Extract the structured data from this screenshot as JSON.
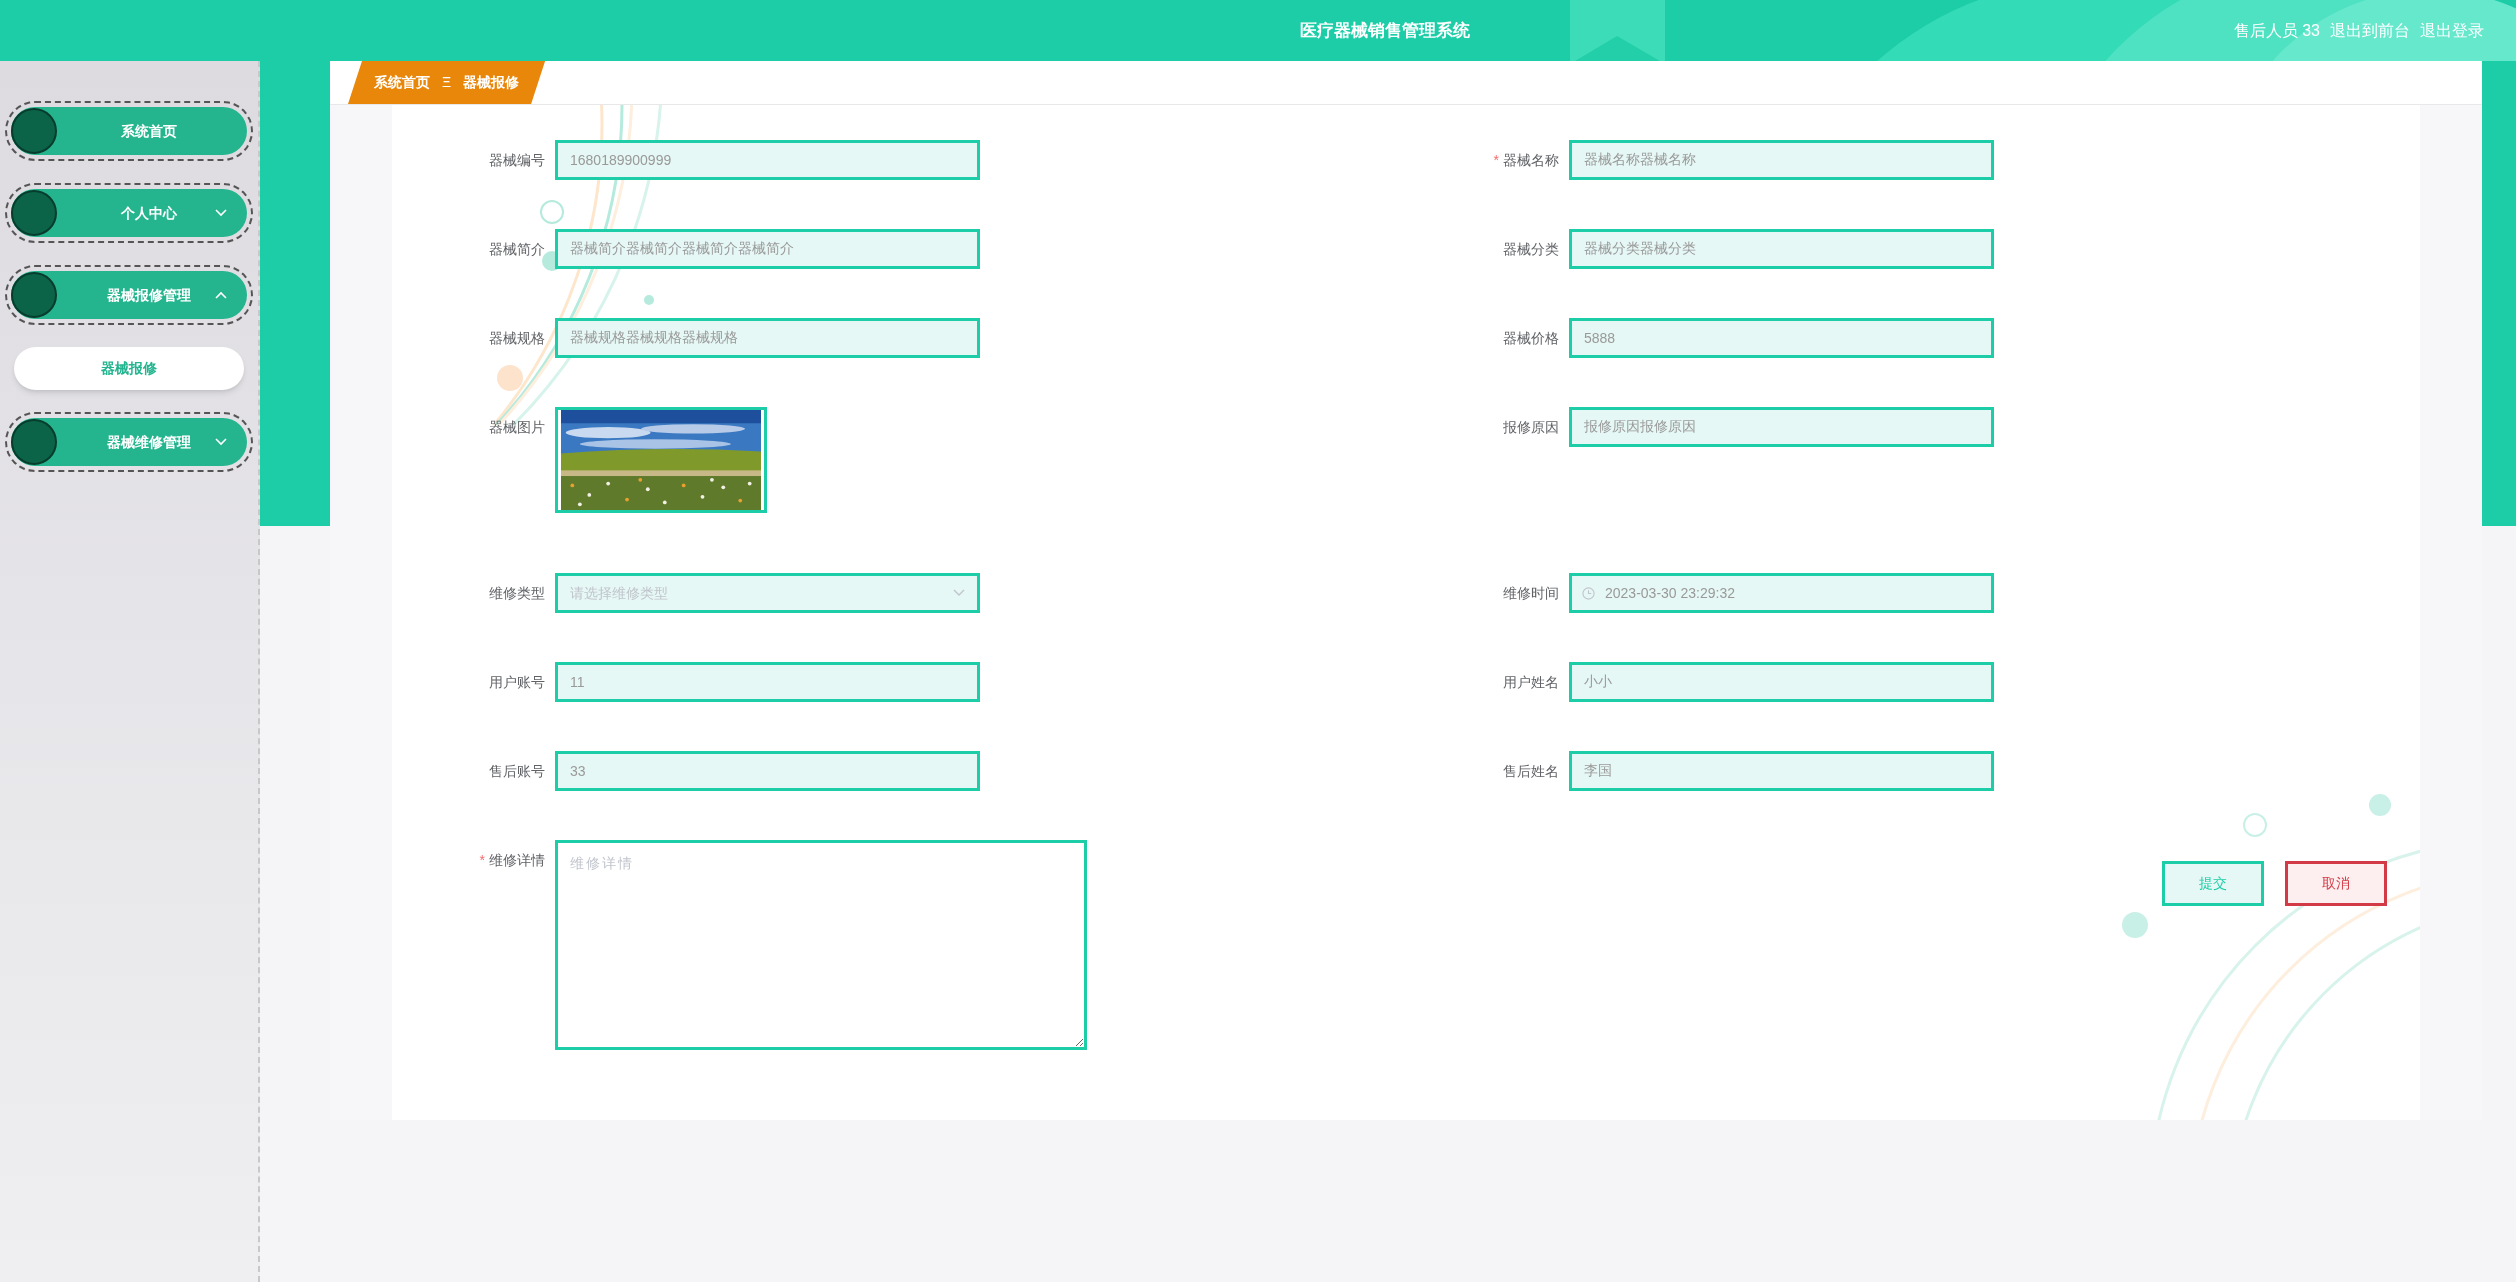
{
  "header": {
    "title": "医疗器械销售管理系统",
    "user": "售后人员 33",
    "links": [
      "退出到前台",
      "退出登录"
    ]
  },
  "sidebar": {
    "items": [
      {
        "label": "系统首页",
        "selected": false
      },
      {
        "label": "个人中心",
        "selected": false,
        "expanded": false
      },
      {
        "label": "器械报修管理",
        "selected": false,
        "expanded": true,
        "children": [
          {
            "label": "器械报修",
            "selected": true
          }
        ]
      },
      {
        "label": "器械维修管理",
        "selected": false,
        "expanded": false
      }
    ]
  },
  "breadcrumb": {
    "items": [
      "系统首页",
      "器械报修"
    ],
    "separator": "Ξ"
  },
  "form": {
    "fields": [
      {
        "label": "器械编号",
        "kind": "text",
        "value": "1680189900999"
      },
      {
        "label": "器械名称",
        "required_mark": "*",
        "kind": "text",
        "value": "器械名称器械名称"
      },
      {
        "label": "器械简介",
        "kind": "text",
        "value": "器械简介器械简介器械简介器械简介"
      },
      {
        "label": "器械分类",
        "kind": "text",
        "value": "器械分类器械分类"
      },
      {
        "label": "器械规格",
        "kind": "text",
        "value": "器械规格器械规格器械规格"
      },
      {
        "label": "器械价格",
        "kind": "text",
        "value": "5888"
      },
      {
        "label": "器械图片"
      },
      {
        "label": "报修原因",
        "kind": "text",
        "value": "报修原因报修原因"
      },
      {
        "label": "维修类型",
        "kind": "select",
        "placeholder": "请选择维修类型"
      },
      {
        "label": "维修时间",
        "kind": "datetime",
        "value": "2023-03-30 23:29:32"
      },
      {
        "label": "用户账号",
        "kind": "text",
        "value": "11"
      },
      {
        "label": "用户姓名",
        "kind": "text",
        "value": "小小"
      },
      {
        "label": "售后账号",
        "kind": "text",
        "value": "33"
      },
      {
        "label": "售后姓名",
        "kind": "text",
        "value": "李国"
      },
      {
        "label": "维修详情",
        "required_mark": "*",
        "kind": "textarea",
        "placeholder": "维修详情"
      }
    ],
    "buttons": [
      {
        "label": "提交",
        "kind": "submit"
      },
      {
        "label": "取消",
        "kind": "cancel"
      }
    ]
  }
}
